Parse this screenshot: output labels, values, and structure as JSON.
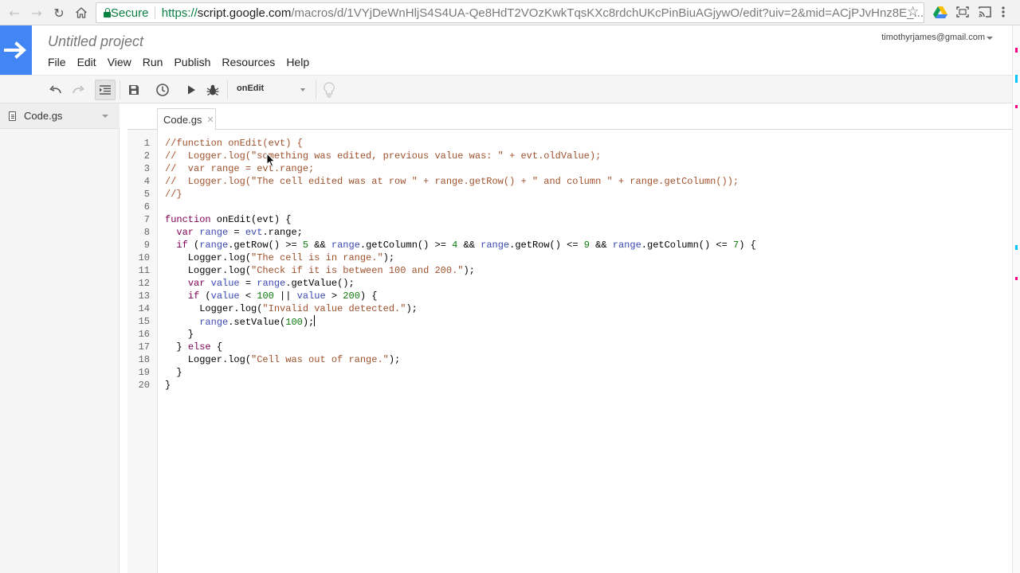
{
  "browser": {
    "secure_label": "Secure",
    "url_scheme": "https://",
    "url_host": "script.google.com",
    "url_path": "/macros/d/1VYjDeWnHljS4S4UA-Qe8HdT2VOzKwkTqsKXc8rdchUKcPinBiuAGjywO/edit?uiv=2&mid=ACjPJvHnz8E_...",
    "icons": [
      "back-icon",
      "forward-icon",
      "reload-icon",
      "home-icon",
      "lock-icon",
      "star-icon",
      "drive-icon",
      "screenshot-icon",
      "cast-icon",
      "menu-icon"
    ]
  },
  "header": {
    "project_title": "Untitled project",
    "account_email": "timothyrjames@gmail.com",
    "logo_color": "#4285f4"
  },
  "menu": {
    "items": [
      "File",
      "Edit",
      "View",
      "Run",
      "Publish",
      "Resources",
      "Help"
    ]
  },
  "toolbar": {
    "function_selector": "onEdit",
    "icons": [
      "undo-icon",
      "redo-icon",
      "indent-icon",
      "save-icon",
      "triggers-icon",
      "run-icon",
      "debug-icon",
      "lightbulb-icon"
    ]
  },
  "files": {
    "items": [
      {
        "label": "Code.gs"
      }
    ]
  },
  "editor": {
    "tab_label": "Code.gs",
    "line_numbers": [
      "1",
      "2",
      "3",
      "4",
      "5",
      "6",
      "7",
      "8",
      "9",
      "10",
      "11",
      "12",
      "13",
      "14",
      "15",
      "16",
      "17",
      "18",
      "19",
      "20"
    ],
    "lines": [
      [
        {
          "t": "//function onEdit(evt) {",
          "c": "comment"
        }
      ],
      [
        {
          "t": "//  Logger.log(\"something was edited, previous value was: \" + evt.oldValue);",
          "c": "comment"
        }
      ],
      [
        {
          "t": "//  var range = evt.range;",
          "c": "comment"
        }
      ],
      [
        {
          "t": "//  Logger.log(\"The cell edited was at row \" + range.getRow() + \" and column \" + range.getColumn());",
          "c": "comment"
        }
      ],
      [
        {
          "t": "//}",
          "c": "comment"
        }
      ],
      [],
      [
        {
          "t": "function",
          "c": "kw"
        },
        {
          "t": " onEdit(evt) {",
          "c": "plain"
        }
      ],
      [
        {
          "t": "  ",
          "c": "plain"
        },
        {
          "t": "var",
          "c": "kw"
        },
        {
          "t": " ",
          "c": "plain"
        },
        {
          "t": "range",
          "c": "var"
        },
        {
          "t": " = ",
          "c": "plain"
        },
        {
          "t": "evt",
          "c": "var"
        },
        {
          "t": ".range;",
          "c": "plain"
        }
      ],
      [
        {
          "t": "  ",
          "c": "plain"
        },
        {
          "t": "if",
          "c": "kw"
        },
        {
          "t": " (",
          "c": "plain"
        },
        {
          "t": "range",
          "c": "var"
        },
        {
          "t": ".getRow() >= ",
          "c": "plain"
        },
        {
          "t": "5",
          "c": "num"
        },
        {
          "t": " && ",
          "c": "plain"
        },
        {
          "t": "range",
          "c": "var"
        },
        {
          "t": ".getColumn() >= ",
          "c": "plain"
        },
        {
          "t": "4",
          "c": "num"
        },
        {
          "t": " && ",
          "c": "plain"
        },
        {
          "t": "range",
          "c": "var"
        },
        {
          "t": ".getRow() <= ",
          "c": "plain"
        },
        {
          "t": "9",
          "c": "num"
        },
        {
          "t": " && ",
          "c": "plain"
        },
        {
          "t": "range",
          "c": "var"
        },
        {
          "t": ".getColumn() <= ",
          "c": "plain"
        },
        {
          "t": "7",
          "c": "num"
        },
        {
          "t": ") {",
          "c": "plain"
        }
      ],
      [
        {
          "t": "    Logger.log(",
          "c": "plain"
        },
        {
          "t": "\"The cell is in range.\"",
          "c": "str"
        },
        {
          "t": ");",
          "c": "plain"
        }
      ],
      [
        {
          "t": "    Logger.log(",
          "c": "plain"
        },
        {
          "t": "\"Check if it is between 100 and 200.\"",
          "c": "str"
        },
        {
          "t": ");",
          "c": "plain"
        }
      ],
      [
        {
          "t": "    ",
          "c": "plain"
        },
        {
          "t": "var",
          "c": "kw"
        },
        {
          "t": " ",
          "c": "plain"
        },
        {
          "t": "value",
          "c": "var"
        },
        {
          "t": " = ",
          "c": "plain"
        },
        {
          "t": "range",
          "c": "var"
        },
        {
          "t": ".getValue();",
          "c": "plain"
        }
      ],
      [
        {
          "t": "    ",
          "c": "plain"
        },
        {
          "t": "if",
          "c": "kw"
        },
        {
          "t": " (",
          "c": "plain"
        },
        {
          "t": "value",
          "c": "var"
        },
        {
          "t": " < ",
          "c": "plain"
        },
        {
          "t": "100",
          "c": "num"
        },
        {
          "t": " || ",
          "c": "plain"
        },
        {
          "t": "value",
          "c": "var"
        },
        {
          "t": " > ",
          "c": "plain"
        },
        {
          "t": "200",
          "c": "num"
        },
        {
          "t": ") {",
          "c": "plain"
        }
      ],
      [
        {
          "t": "      Logger.log(",
          "c": "plain"
        },
        {
          "t": "\"Invalid value detected.\"",
          "c": "str"
        },
        {
          "t": ");",
          "c": "plain"
        }
      ],
      [
        {
          "t": "      ",
          "c": "plain"
        },
        {
          "t": "range",
          "c": "var"
        },
        {
          "t": ".setValue(",
          "c": "plain"
        },
        {
          "t": "100",
          "c": "num"
        },
        {
          "t": ");",
          "c": "plain"
        },
        {
          "caret": true
        }
      ],
      [
        {
          "t": "    }",
          "c": "plain"
        }
      ],
      [
        {
          "t": "  } ",
          "c": "plain"
        },
        {
          "t": "else",
          "c": "kw"
        },
        {
          "t": " {",
          "c": "plain"
        }
      ],
      [
        {
          "t": "    Logger.log(",
          "c": "plain"
        },
        {
          "t": "\"Cell was out of range.\"",
          "c": "str"
        },
        {
          "t": ");",
          "c": "plain"
        }
      ],
      [
        {
          "t": "  }",
          "c": "plain"
        }
      ],
      [
        {
          "t": "}",
          "c": "plain"
        }
      ]
    ]
  }
}
